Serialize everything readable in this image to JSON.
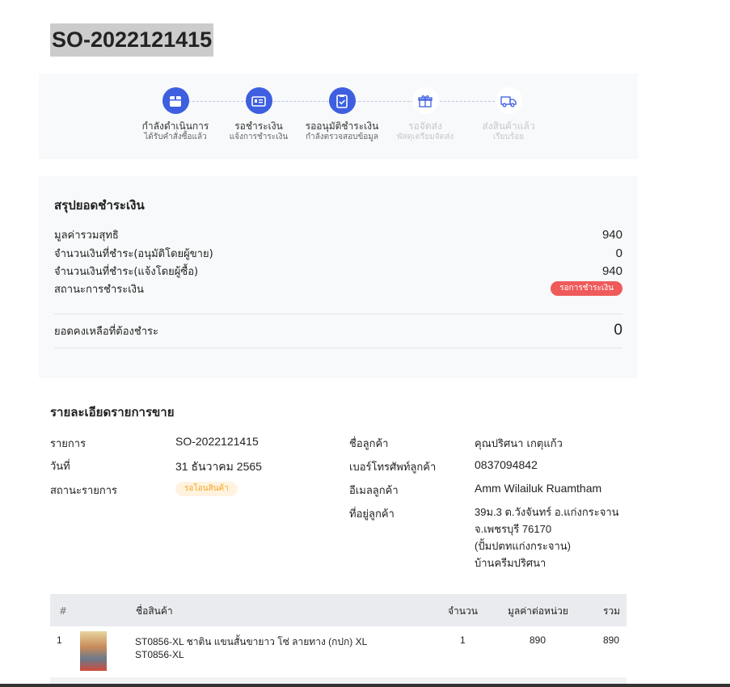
{
  "order": {
    "title": "SO-2022121415"
  },
  "stepper": {
    "steps": [
      {
        "title": "กำลังดำเนินการ",
        "subtitle": "ได้รับคำสั่งซื้อแล้ว",
        "icon": "box-icon",
        "state": "done"
      },
      {
        "title": "รอชำระเงิน",
        "subtitle": "แจ้งการชำระเงิน",
        "icon": "payment-card-icon",
        "state": "done"
      },
      {
        "title": "รออนุมัติชำระเงิน",
        "subtitle": "กำลังตรวจสอบข้อมูล",
        "icon": "clipboard-check-icon",
        "state": "done"
      },
      {
        "title": "รอจัดส่ง",
        "subtitle": "พัสดุเตรียมจัดส่ง",
        "icon": "gift-box-icon",
        "state": "pending"
      },
      {
        "title": "ส่งสินค้าแล้ว",
        "subtitle": "เรียบร้อย",
        "icon": "truck-icon",
        "state": "pending"
      }
    ],
    "accent_color": "#3d5fe0",
    "pending_color": "#c4c8ce"
  },
  "summary": {
    "title": "สรุปยอดชำระเงิน",
    "rows": [
      {
        "label": "มูลค่ารวมสุทธิ",
        "value": "940"
      },
      {
        "label": "จำนวนเงินที่ชำระ(อนุมัติโดยผู้ขาย)",
        "value": "0"
      },
      {
        "label": "จำนวนเงินที่ชำระ(แจ้งโดยผู้ซื้อ)",
        "value": "940"
      }
    ],
    "status_label": "สถานะการชำระเงิน",
    "status_badge": "รอการชำระเงิน",
    "status_color": "#ef5a5a",
    "balance_label": "ยอดคงเหลือที่ต้องชำระ",
    "balance_value": "0"
  },
  "details": {
    "title": "รายละเอียดรายการขาย",
    "order_label": "รายการ",
    "order_value": "SO-2022121415",
    "date_label": "วันที่",
    "date_value": "31 ธันวาคม 2565",
    "status_label": "สถานะรายการ",
    "status_badge": "รอโอนสินค้า",
    "customer_name_label": "ชื่อลูกค้า",
    "customer_name_value": "คุณปริศนา เกตุแก้ว",
    "phone_label": "เบอร์โทรศัพท์ลูกค้า",
    "phone_value": "0837094842",
    "email_label": "อีเมลลูกค้า",
    "email_value": "Amm Wilailuk Ruamtham",
    "address_label": "ที่อยู่ลูกค้า",
    "address_lines": [
      "39ม.3 ต.วังจันทร์ อ.แก่งกระจาน",
      "จ.เพชรบุรี 76170",
      "(ปั้มปตทแก่งกระจาน)",
      "บ้านครีมปริศนา"
    ]
  },
  "table": {
    "headers": {
      "num": "#",
      "name": "ชื่อสินค้า",
      "qty": "จำนวน",
      "unit_price": "มูลค่าต่อหน่วย",
      "total": "รวม"
    },
    "rows": [
      {
        "num": "1",
        "name_line1": "ST0856-XL ชาติน แขนสั้นขายาว โซ่ ลายทาง (กปก) XL",
        "name_line2": "ST0856-XL",
        "qty": "1",
        "unit_price": "890",
        "total": "890"
      }
    ]
  }
}
